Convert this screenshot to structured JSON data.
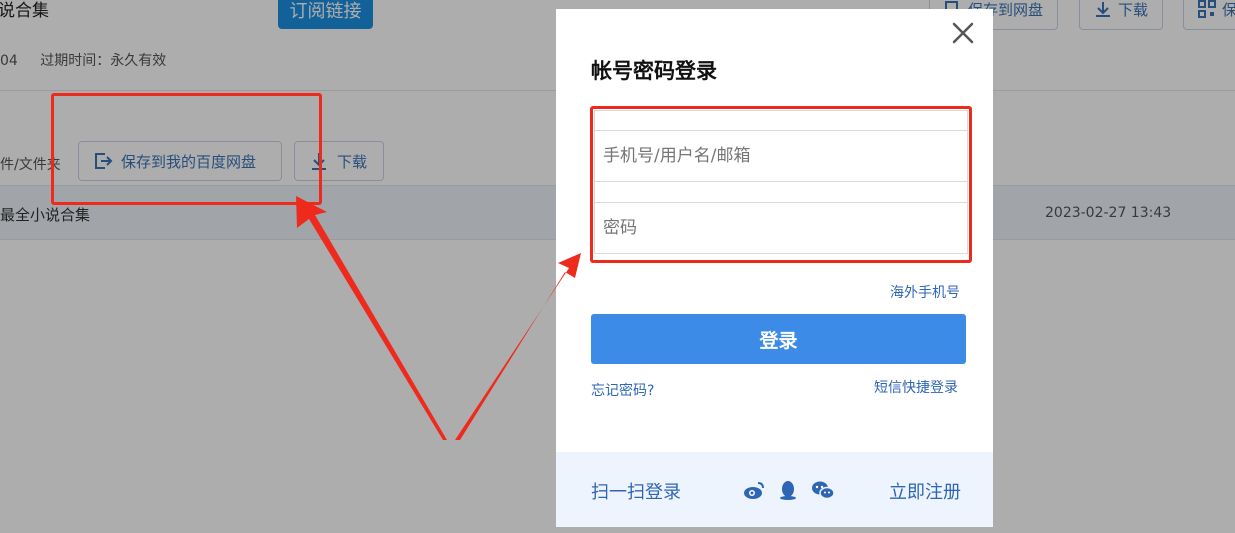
{
  "background": {
    "page_title": "说合集",
    "subscribe_label": "订阅链接",
    "meta_code": "04",
    "meta_expiry": "过期时间：永久有效",
    "top_save_label": "保存到网盘",
    "top_download_label": "下载",
    "top_qr_label": "保",
    "file_column_label": "件/文件夹",
    "save_to_baidu_label": "保存到我的百度网盘",
    "download_label": "下载",
    "file_row": {
      "name": "最全小说合集",
      "date": "2023-02-27 13:43"
    }
  },
  "modal": {
    "title": "帐号密码登录",
    "username_placeholder": "手机号/用户名/邮箱",
    "password_placeholder": "密码",
    "overseas_phone_link": "海外手机号",
    "login_label": "登录",
    "forgot_password_link": "忘记密码?",
    "sms_login_link": "短信快捷登录",
    "scan_login_link": "扫一扫登录",
    "register_link": "立即注册",
    "social_icons": [
      "weibo-icon",
      "qq-icon",
      "wechat-icon"
    ]
  },
  "colors": {
    "accent": "#3c8be7",
    "link": "#2f66b4",
    "annotation": "#ee2a1d",
    "subscribe": "#1b8fe0"
  }
}
